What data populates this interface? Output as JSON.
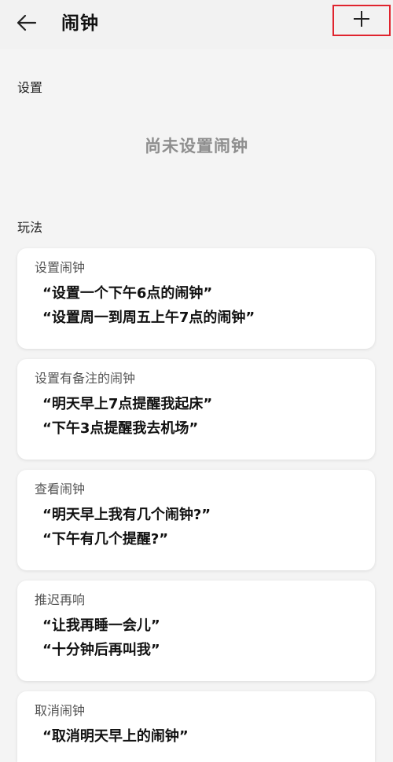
{
  "header": {
    "title": "闹钟",
    "back_icon": "arrow-left-icon",
    "add_icon": "plus-icon",
    "highlight_color": "#e0242e"
  },
  "settings_section": {
    "label": "设置",
    "empty_text": "尚未设置闹钟"
  },
  "usage_section": {
    "label": "玩法",
    "cards": [
      {
        "title": "设置闹钟",
        "examples": [
          "“设置一个下午6点的闹钟”",
          "“设置周一到周五上午7点的闹钟”"
        ]
      },
      {
        "title": "设置有备注的闹钟",
        "examples": [
          "“明天早上7点提醒我起床”",
          "“下午3点提醒我去机场”"
        ]
      },
      {
        "title": "查看闹钟",
        "examples": [
          "“明天早上我有几个闹钟?”",
          "“下午有几个提醒?”"
        ]
      },
      {
        "title": "推迟再响",
        "examples": [
          "“让我再睡一会儿”",
          "“十分钟后再叫我”"
        ]
      },
      {
        "title": "取消闹钟",
        "examples": [
          "“取消明天早上的闹钟”"
        ]
      }
    ]
  }
}
